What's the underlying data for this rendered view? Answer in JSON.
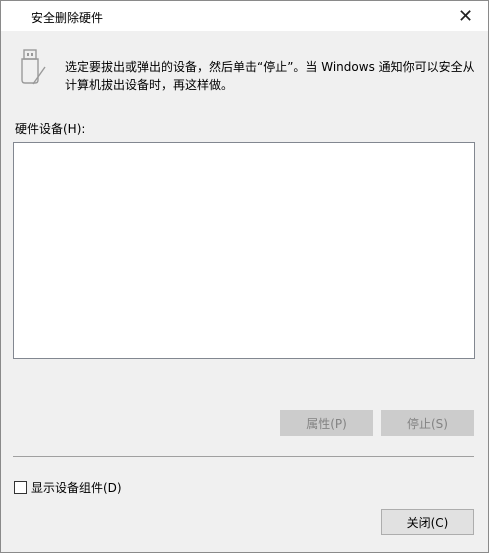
{
  "window": {
    "title": "安全删除硬件",
    "close_glyph": "✕"
  },
  "main": {
    "instruction": "选定要拔出或弹出的设备，然后单击“停止”。当 Windows  通知你可以安全从计算机拔出设备时，再这样做。",
    "hardware_label": "硬件设备(H):",
    "devices": []
  },
  "buttons": {
    "properties": "属性(P)",
    "stop": "停止(S)",
    "close": "关闭(C)"
  },
  "options": {
    "show_components_label": "显示设备组件(D)",
    "show_components_checked": false
  },
  "icons": {
    "usb": "usb-drive-icon"
  },
  "colors": {
    "window_bg": "#f0f0f0",
    "disabled_button": "#cccccc",
    "disabled_text": "#838383"
  }
}
